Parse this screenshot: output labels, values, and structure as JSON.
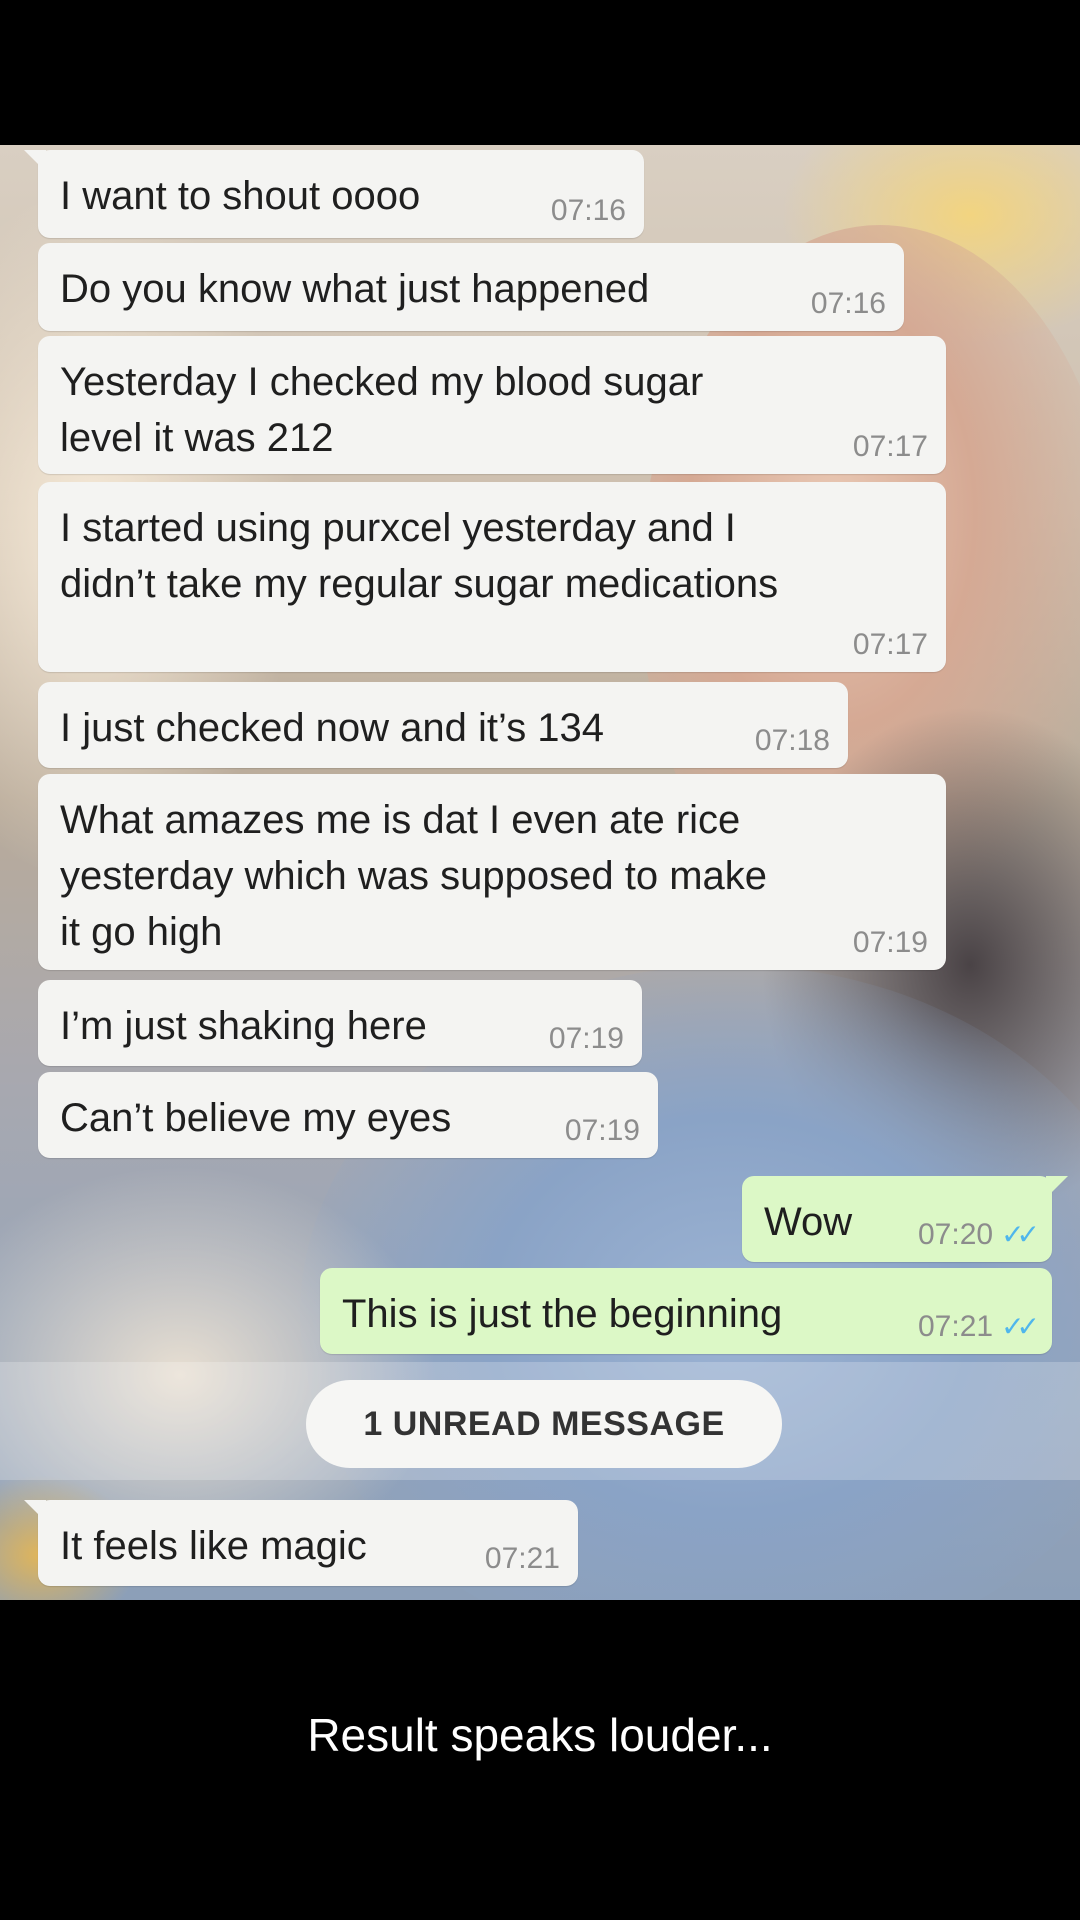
{
  "messages": [
    {
      "text": "I want to shout oooo",
      "time": "07:16",
      "direction": "incoming"
    },
    {
      "text": "Do you know what just happened",
      "time": "07:16",
      "direction": "incoming"
    },
    {
      "text": "Yesterday I checked my blood sugar\nlevel it was 212",
      "time": "07:17",
      "direction": "incoming"
    },
    {
      "text": "I started using purxcel yesterday and I\ndidn’t take my regular sugar medications",
      "time": "07:17",
      "direction": "incoming"
    },
    {
      "text": "I just checked now and it’s 134",
      "time": "07:18",
      "direction": "incoming"
    },
    {
      "text": "What amazes me is dat I even ate rice\nyesterday which was supposed to make\nit go high",
      "time": "07:19",
      "direction": "incoming"
    },
    {
      "text": "I’m just shaking here",
      "time": "07:19",
      "direction": "incoming"
    },
    {
      "text": "Can’t believe my eyes",
      "time": "07:19",
      "direction": "incoming"
    },
    {
      "text": "Wow",
      "time": "07:20",
      "direction": "outgoing",
      "status": "read"
    },
    {
      "text": "This is just the beginning",
      "time": "07:21",
      "direction": "outgoing",
      "status": "read"
    },
    {
      "text": "It feels like magic",
      "time": "07:21",
      "direction": "incoming"
    }
  ],
  "unread_banner": "1 UNREAD MESSAGE",
  "caption": "Result speaks louder...",
  "colors": {
    "incoming_bubble": "#f4f4f2",
    "outgoing_bubble": "#dcf8c6",
    "read_ticks": "#4fb6ec",
    "timestamp": "#8c8c8c",
    "background": "#000000"
  }
}
